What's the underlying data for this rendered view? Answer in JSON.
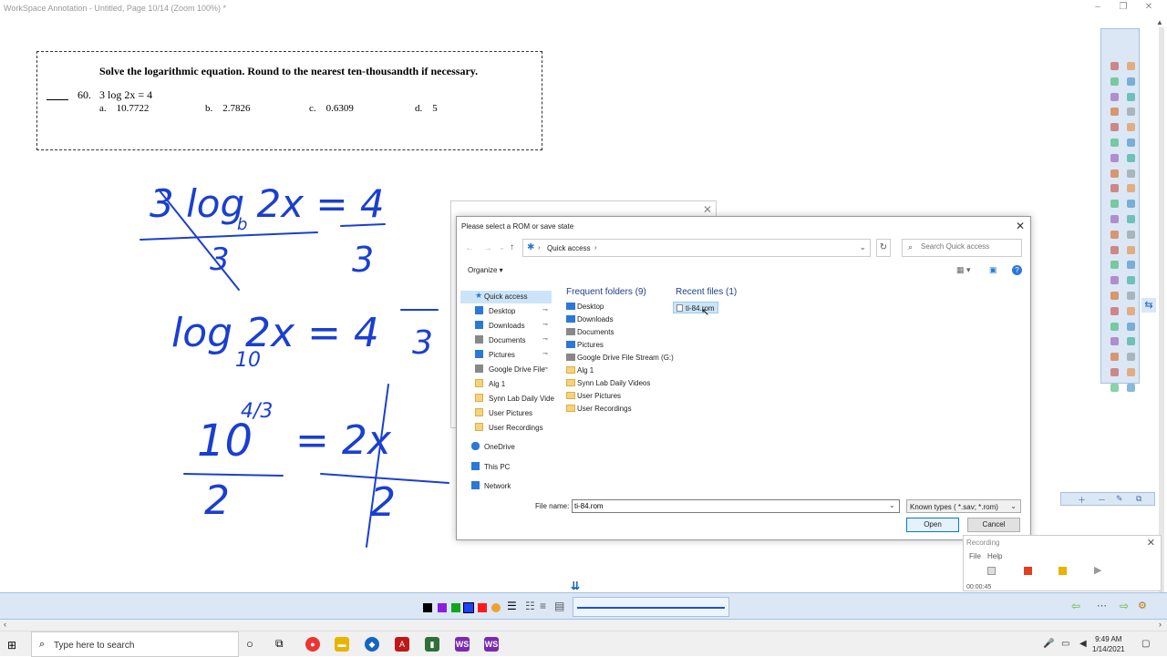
{
  "app": {
    "title": "WorkSpace Annotation - Untitled, Page 10/14  (Zoom 100%) *",
    "min": "–",
    "max": "❐",
    "close": "✕"
  },
  "question": {
    "header": "Solve the logarithmic equation.  Round to the nearest ten-thousandth if necessary.",
    "number": "60.",
    "equation": "3 log 2x  =  4",
    "choices": [
      {
        "letter": "a.",
        "value": "10.7722"
      },
      {
        "letter": "b.",
        "value": "2.7826"
      },
      {
        "letter": "c.",
        "value": "0.6309"
      },
      {
        "letter": "d.",
        "value": "5"
      }
    ]
  },
  "handwriting": {
    "line1": "3 log 2x = 4",
    "line1_sub": "b",
    "line1_den_left": "3",
    "line1_den_right": "3",
    "line2": "log 2x = 4",
    "line2_sub": "10",
    "line2_den": "3",
    "line3_base": "10",
    "line3_exp": "4/3",
    "line3_rhs": "= 2x",
    "line3_den_left": "2",
    "line3_den_right": "2"
  },
  "dialog": {
    "title": "Please select a ROM or save state",
    "close": "✕",
    "address": "Quick access",
    "search_placeholder": "Search Quick access",
    "organize": "Organize ▾",
    "nav": {
      "quick_access": "Quick access",
      "pinned": [
        {
          "label": "Desktop",
          "pin": "📌"
        },
        {
          "label": "Downloads",
          "pin": "📌"
        },
        {
          "label": "Documents",
          "pin": "📌"
        },
        {
          "label": "Pictures",
          "pin": "📌"
        },
        {
          "label": "Google Drive File",
          "pin": "📌"
        }
      ],
      "folders": [
        "Alg 1",
        "Synn Lab Daily Vide",
        "User Pictures",
        "User Recordings"
      ],
      "onedrive": "OneDrive",
      "this_pc": "This PC",
      "network": "Network"
    },
    "frequent_header": "Frequent folders (9)",
    "recent_header": "Recent files (1)",
    "frequent": [
      "Desktop",
      "Downloads",
      "Documents",
      "Pictures",
      "Google Drive File Stream (G:)",
      "Alg 1",
      "Synn Lab Daily Videos",
      "User Pictures",
      "User Recordings"
    ],
    "recent_file": "ti-84.rom",
    "filename_label": "File name:",
    "filename_value": "ti-84.rom",
    "filetype": "Known types ( *.sav; *.rom)",
    "open": "Open",
    "cancel": "Cancel"
  },
  "recording": {
    "title": "Recording",
    "menu_file": "File",
    "menu_help": "Help",
    "timer": "00:00:45"
  },
  "taskbar": {
    "search": "Type here to search",
    "time": "9:49 AM",
    "date": "1/14/2021",
    "apps": [
      "WS",
      "WS"
    ]
  },
  "colors": {
    "accent": "#2b78d6",
    "ink": "#1a3fd0",
    "toolbar_bg": "#dbe7f5",
    "swatches": [
      "#000000",
      "#8a1ee0",
      "#13a51a",
      "#1e40ff",
      "#ff1a1a"
    ]
  }
}
